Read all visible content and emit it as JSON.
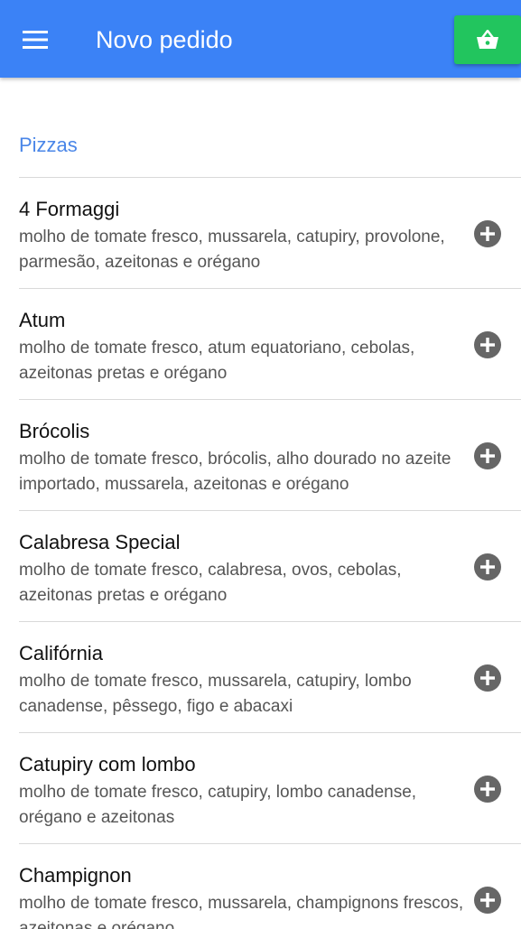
{
  "header": {
    "menu_icon": "menu-icon",
    "title": "Novo pedido",
    "cart_icon": "shopping-basket-icon",
    "color": "#3b82f6",
    "cart_color": "#22c55e"
  },
  "section": {
    "title": "Pizzas"
  },
  "items": [
    {
      "name": "4 Formaggi",
      "description": "molho de tomate fresco, mussarela, catupiry, provolone, parmesão, azeitonas e orégano"
    },
    {
      "name": "Atum",
      "description": "molho de tomate fresco, atum equatoriano, cebolas, azeitonas pretas e orégano"
    },
    {
      "name": "Brócolis",
      "description": "molho de tomate fresco, brócolis, alho dourado no azeite importado, mussarela, azeitonas e orégano"
    },
    {
      "name": "Calabresa Special",
      "description": "molho de tomate fresco, calabresa, ovos, cebolas, azeitonas pretas e orégano"
    },
    {
      "name": "Califórnia",
      "description": "molho de tomate fresco, mussarela, catupiry, lombo canadense, pêssego, figo e abacaxi"
    },
    {
      "name": "Catupiry com lombo",
      "description": "molho de tomate fresco, catupiry, lombo canadense, orégano e azeitonas"
    },
    {
      "name": "Champignon",
      "description": "molho de tomate fresco, mussarela, champignons frescos, azeitonas e orégano"
    }
  ]
}
